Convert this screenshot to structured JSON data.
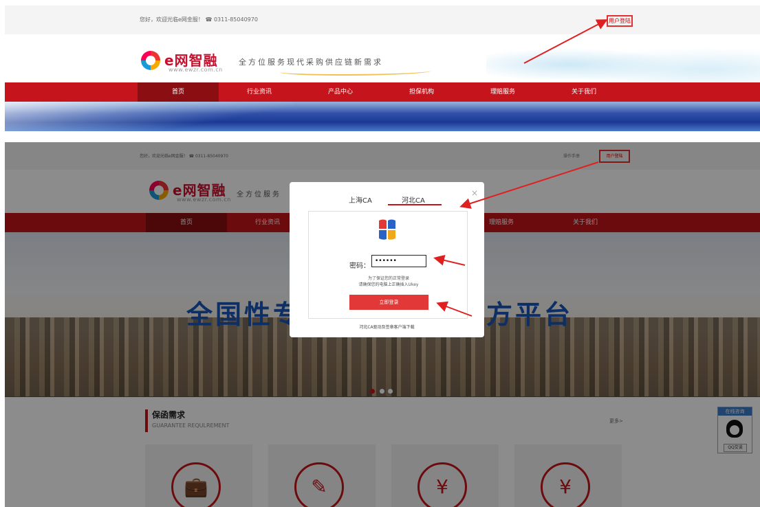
{
  "panel1": {
    "header": {
      "greeting": "您好，欢迎光临e网金服！ ☎ 0311-85040970",
      "login_label": "用户登陆"
    },
    "logo": {
      "brand": "e网智融",
      "url": "www.ewzr.com.cn"
    },
    "slogan": "全方位服务现代采购供应链新需求",
    "nav": [
      "首页",
      "行业资讯",
      "产品中心",
      "担保机构",
      "理赔服务",
      "关于我们"
    ]
  },
  "panel2": {
    "header": {
      "greeting": "您好，欢迎光临e网金服！ ☎ 0311-85040970",
      "manual": "操作手册",
      "login_label": "用户登陆"
    },
    "logo": {
      "brand": "e网智融",
      "url": "www.ewzr.com.cn"
    },
    "slogan": "全方位服务",
    "nav": [
      "首页",
      "行业资讯",
      "",
      "",
      "理赔服务",
      "关于我们"
    ],
    "banner_left": "全国性专",
    "banner_right": "方平台",
    "section": {
      "title": "保函需求",
      "subtitle": "GUARANTEE REQULREMENT",
      "more": "更多>"
    },
    "qq": {
      "title": "在线咨询",
      "button": "QQ交谈"
    },
    "modal": {
      "tabs": [
        "上海CA",
        "河北CA"
      ],
      "close_label": "×",
      "password_label": "密码：",
      "password_value": "••••••",
      "tip_line1": "为了保证您的正常登录",
      "tip_line2": "请确保您的电脑上正确插入Ukey",
      "submit_label": "立即登录",
      "download_label": "河北CA驱动及签章客户端下载"
    }
  },
  "colors": {
    "brand_red": "#c5141b",
    "annotation_red": "#e03030",
    "banner_blue": "#1a56b8"
  }
}
